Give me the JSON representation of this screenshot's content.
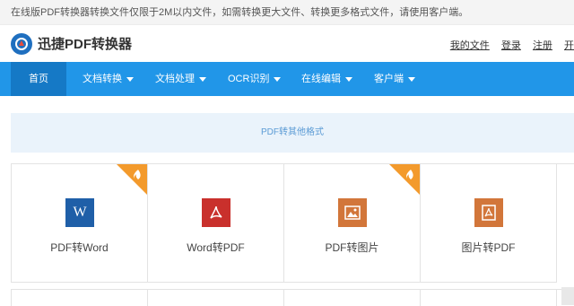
{
  "notice": "在线版PDF转换器转换文件仅限于2M以内文件，如需转换更大文件、转换更多格式文件，请使用客户端。",
  "header": {
    "logo_text": "迅捷PDF转换器",
    "links": [
      "我的文件",
      "登录",
      "注册",
      "开"
    ]
  },
  "nav": {
    "items": [
      {
        "label": "首页"
      },
      {
        "label": "文档转换"
      },
      {
        "label": "文档处理"
      },
      {
        "label": "OCR识别"
      },
      {
        "label": "在线编辑"
      },
      {
        "label": "客户端"
      }
    ]
  },
  "banner": "PDF转其他格式",
  "cards": [
    {
      "label": "PDF转Word",
      "icon": "word-icon",
      "color": "#1f5fa8",
      "hot": true
    },
    {
      "label": "Word转PDF",
      "icon": "pdf-icon",
      "color": "#c9302c",
      "hot": false
    },
    {
      "label": "PDF转图片",
      "icon": "image-icon",
      "color": "#d2763a",
      "hot": true
    },
    {
      "label": "图片转PDF",
      "icon": "pdf-icon",
      "color": "#d2763a",
      "hot": false
    }
  ],
  "colors": {
    "nav_bg": "#2196e8",
    "nav_active": "#1579c6",
    "hot_badge": "#f39a2c",
    "banner_bg": "#eaf3fb"
  }
}
